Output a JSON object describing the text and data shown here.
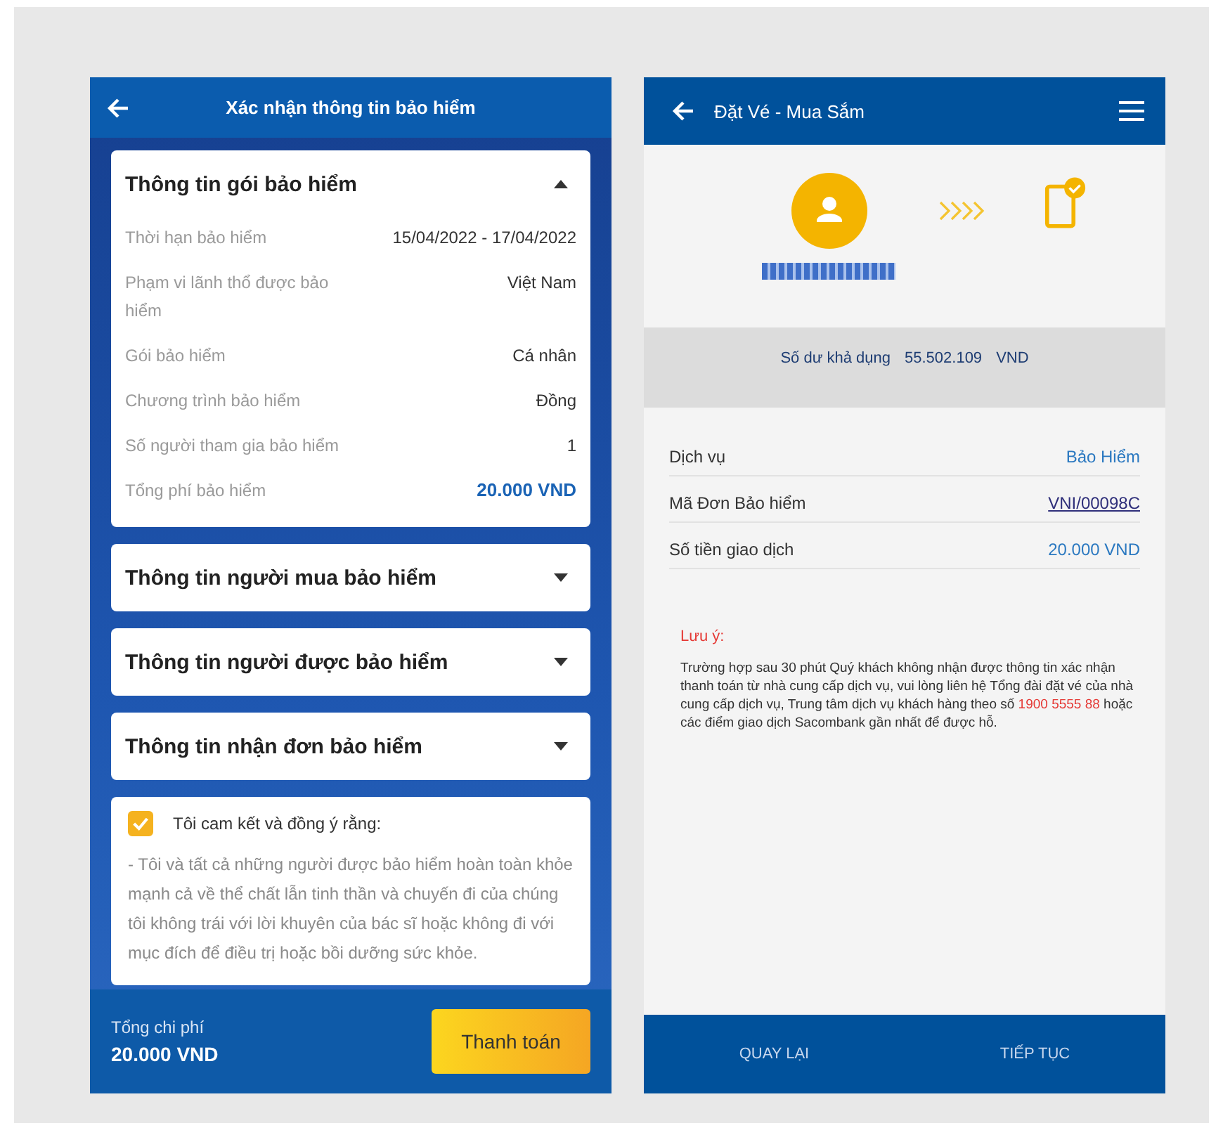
{
  "left_screen": {
    "header": {
      "title": "Xác nhận thông tin bảo hiểm"
    },
    "sections": [
      {
        "title": "Thông tin gói bảo hiểm",
        "expanded": true,
        "rows": [
          {
            "label": "Thời hạn bảo hiểm",
            "value": "15/04/2022 - 17/04/2022",
            "kind": "plain"
          },
          {
            "label": "Phạm vi lãnh thổ được bảo hiểm",
            "value": "Việt Nam",
            "kind": "plain"
          },
          {
            "label": "Gói bảo hiểm",
            "value": "Cá nhân",
            "kind": "plain"
          },
          {
            "label": "Chương trình bảo hiểm",
            "value": "Đồng",
            "kind": "plain"
          },
          {
            "label": "Số người tham gia bảo hiểm",
            "value": "1",
            "kind": "plain"
          },
          {
            "label": "Tổng phí bảo hiểm",
            "value": "20.000 VND",
            "kind": "total"
          }
        ]
      },
      {
        "title": "Thông tin người mua bảo hiểm",
        "expanded": false
      },
      {
        "title": "Thông tin người được bảo hiểm",
        "expanded": false
      },
      {
        "title": "Thông tin nhận đơn bảo hiểm",
        "expanded": false
      }
    ],
    "consent": {
      "checked": true,
      "label": "Tôi cam kết và đồng ý rằng:",
      "text": "- Tôi và tất cả những người được bảo hiểm hoàn toàn khỏe mạnh cả về thể chất lẫn tinh thần và chuyến đi của chúng tôi không trái với lời khuyên của bác sĩ hoặc không đi với mục đích để điều trị hoặc bồi dưỡng sức khỏe."
    },
    "footer": {
      "total_label": "Tổng chi phí",
      "total_value": "20.000 VND",
      "button": "Thanh toán"
    }
  },
  "right_screen": {
    "header": {
      "title": "Đặt Vé - Mua Sắm"
    },
    "balance": {
      "label": "Số dư khả dụng",
      "value": "55.502.109",
      "currency": "VND"
    },
    "rows": [
      {
        "label": "Dịch vụ",
        "value": "Bảo Hiểm",
        "kind": "plain"
      },
      {
        "label": "Mã Đơn Bảo hiểm",
        "value": "VNI/00098C",
        "kind": "link"
      },
      {
        "label": "Số tiền giao dịch",
        "value": "20.000 VND",
        "kind": "plain"
      }
    ],
    "note": {
      "title": "Lưu ý:",
      "before": "Trường hợp sau 30 phút Quý khách không nhận được thông tin xác nhận thanh toán từ nhà cung cấp dịch vụ, vui lòng liên hệ Tổng đài đặt vé của nhà cung cấp dịch vụ, Trung tâm dịch vụ khách hàng theo số ",
      "phone": "1900 5555 88",
      "after": " hoặc các điểm giao dịch Sacombank gần nhất để được hỗ."
    },
    "buttons": [
      "QUAY LẠI",
      "TIẾP TỤC"
    ]
  }
}
